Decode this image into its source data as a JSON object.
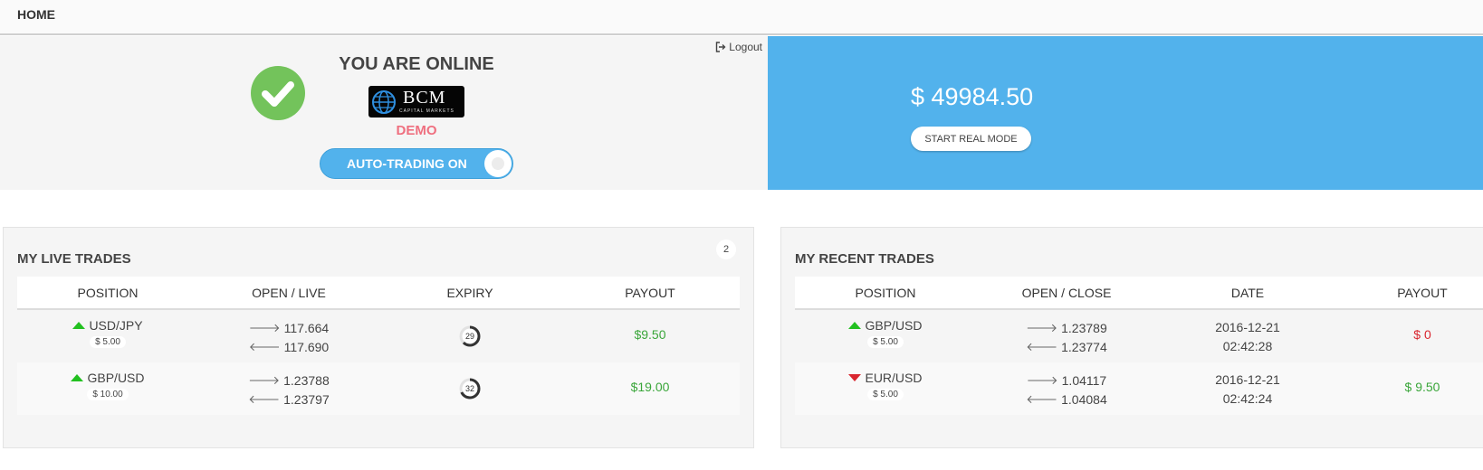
{
  "topbar": {
    "home_label": "HOME"
  },
  "status": {
    "logout_label": "Logout",
    "title": "YOU ARE ONLINE",
    "logo": {
      "name": "BCM",
      "subtitle": "CAPITAL MARKETS"
    },
    "mode": "DEMO",
    "auto_trading_label": "AUTO-TRADING ON"
  },
  "balance": {
    "amount": "$ 49984.50",
    "real_mode_label": "START REAL MODE"
  },
  "live_trades": {
    "title": "MY LIVE TRADES",
    "count": "2",
    "headers": [
      "POSITION",
      "OPEN / LIVE",
      "EXPIRY",
      "PAYOUT"
    ],
    "rows": [
      {
        "direction": "up",
        "pair": "USD/JPY",
        "amount": "$ 5.00",
        "open": "117.664",
        "live": "117.690",
        "expiry": "29",
        "expiry_fraction": 0.62,
        "payout": "$9.50"
      },
      {
        "direction": "up",
        "pair": "GBP/USD",
        "amount": "$ 10.00",
        "open": "1.23788",
        "live": "1.23797",
        "expiry": "32",
        "expiry_fraction": 0.68,
        "payout": "$19.00"
      }
    ]
  },
  "recent_trades": {
    "title": "MY RECENT TRADES",
    "headers": [
      "POSITION",
      "OPEN / CLOSE",
      "DATE",
      "PAYOUT"
    ],
    "rows": [
      {
        "direction": "up",
        "pair": "GBP/USD",
        "amount": "$ 5.00",
        "open": "1.23789",
        "close": "1.23774",
        "date": "2016-12-21",
        "time": "02:42:28",
        "payout": "$ 0",
        "result": "loss"
      },
      {
        "direction": "down",
        "pair": "EUR/USD",
        "amount": "$ 5.00",
        "open": "1.04117",
        "close": "1.04084",
        "date": "2016-12-21",
        "time": "02:42:24",
        "payout": "$ 9.50",
        "result": "win"
      }
    ]
  },
  "colors": {
    "accent_blue": "#52b2ec",
    "online_green": "#73c35b",
    "demo_pink": "#ef6f7f",
    "up_green": "#22c020",
    "down_red": "#d9262f"
  }
}
